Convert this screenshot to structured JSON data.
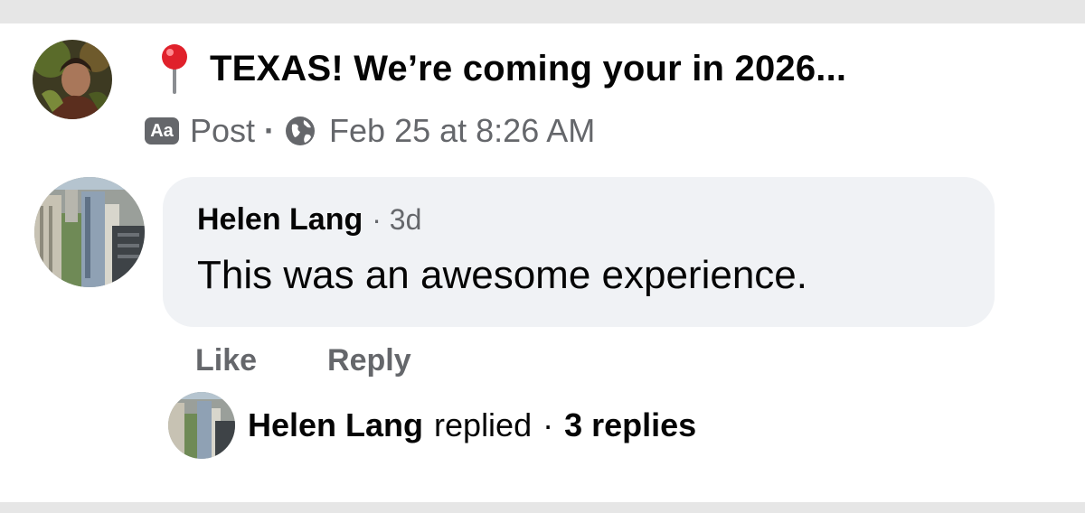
{
  "post": {
    "title": "TEXAS! We’re coming your in 2026...",
    "badge_text": "Aa",
    "type_label": "Post",
    "separator": "·",
    "timestamp": "Feb 25 at 8:26 AM",
    "icons": [
      "pin-icon",
      "aa-icon",
      "globe-icon"
    ]
  },
  "comment": {
    "author": "Helen Lang",
    "separator": "·",
    "time": "3d",
    "text": "This was an awesome experience."
  },
  "actions": {
    "like_label": "Like",
    "reply_label": "Reply"
  },
  "replies": {
    "author": "Helen Lang",
    "verb": "replied",
    "separator": "·",
    "count_label": "3 replies"
  },
  "colors": {
    "secondary_text": "#65676b",
    "bubble_bg": "#f0f2f5",
    "pin_red": "#e0212b"
  }
}
